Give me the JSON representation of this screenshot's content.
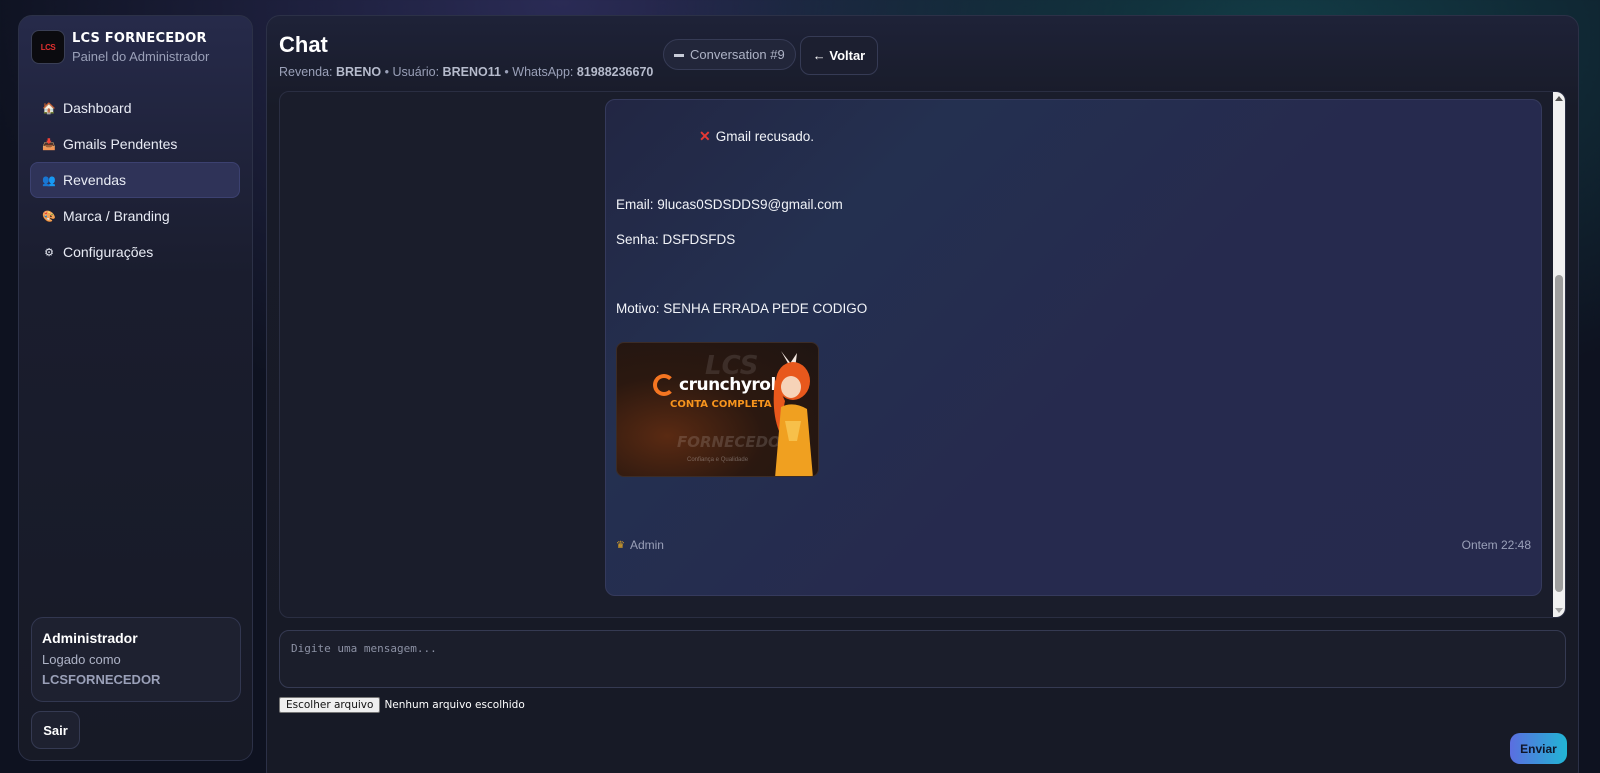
{
  "sidebar": {
    "brand_name": "LCS FORNECEDOR",
    "brand_subtitle": "Painel do Administrador",
    "logo_text": "LCS",
    "nav": [
      {
        "label": "Dashboard",
        "icon": "house-icon",
        "glyph": "🏠"
      },
      {
        "label": "Gmails Pendentes",
        "icon": "inbox-tray-icon",
        "glyph": "📥"
      },
      {
        "label": "Revendas",
        "icon": "people-icon",
        "glyph": "👥"
      },
      {
        "label": "Marca / Branding",
        "icon": "palette-icon",
        "glyph": "🎨"
      },
      {
        "label": "Configurações",
        "icon": "gear-icon",
        "glyph": "⚙"
      }
    ],
    "active_nav": "Revendas",
    "user": {
      "title": "Administrador",
      "logged_as_label": "Logado como",
      "login": "LCSFORNECEDOR"
    },
    "logout_label": "Sair"
  },
  "header": {
    "title": "Chat",
    "meta": {
      "reseller_label": "Revenda:",
      "reseller": "BRENO",
      "sep1": "•",
      "user_label": "Usuário:",
      "user": "BRENO11",
      "sep2": "•",
      "whatsapp_label": "WhatsApp:",
      "whatsapp": "81988236670"
    },
    "conversation_badge": "Conversation #9",
    "back_label": "← Voltar"
  },
  "message": {
    "status": "Gmail recusado.",
    "email_line": "Email: 9lucas0SDSDDS9@gmail.com",
    "password_line": "Senha: DSFDSFDS",
    "reason_line": "Motivo: SENHA ERRADA PEDE CODIGO",
    "image": {
      "brand": "crunchyroll",
      "tagline": "CONTA COMPLETA",
      "watermark_top": "LCS",
      "watermark_bottom": "FORNECEDOR",
      "watermark_sub": "Confiança e Qualidade"
    },
    "sender": "Admin",
    "timestamp": "Ontem 22:48"
  },
  "composer": {
    "placeholder": "Digite uma mensagem...",
    "file_button": "Escolher arquivo",
    "file_status": "Nenhum arquivo escolhido",
    "send_label": "Enviar"
  },
  "colors": {
    "accent_start": "#5b6ee0",
    "accent_end": "#21b5d4",
    "reject_icon": "#e53935",
    "crunchyroll_orange": "#f47521"
  }
}
